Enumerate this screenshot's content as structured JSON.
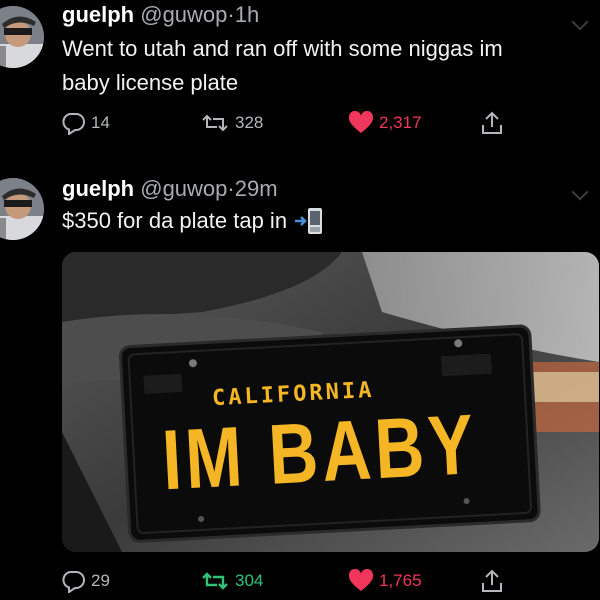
{
  "tweets": [
    {
      "display_name": "guelph",
      "handle": "@guwop",
      "separator": "·",
      "time": "1h",
      "text_line1": "Went to utah and ran off with some niggas im",
      "text_line2": "baby license plate",
      "replies": "14",
      "retweets": "328",
      "likes": "2,317",
      "icons": {
        "reply": "reply-icon",
        "retweet": "retweet-icon",
        "like": "heart-icon",
        "share": "share-icon"
      }
    },
    {
      "display_name": "guelph",
      "handle": "@guwop",
      "separator": "·",
      "time": "29m",
      "text": "$350 for da plate tap in",
      "emoji": "phone-with-arrow-emoji",
      "replies": "29",
      "retweets": "304",
      "likes": "1,765",
      "media": {
        "plate_state": "CALIFORNIA",
        "plate_text": "IM BABY"
      }
    }
  ],
  "colors": {
    "background": "#000000",
    "like": "#f0365a",
    "retweeted": "#2fc37a",
    "muted": "#a8acb1",
    "plate_yellow": "#f4b624"
  }
}
